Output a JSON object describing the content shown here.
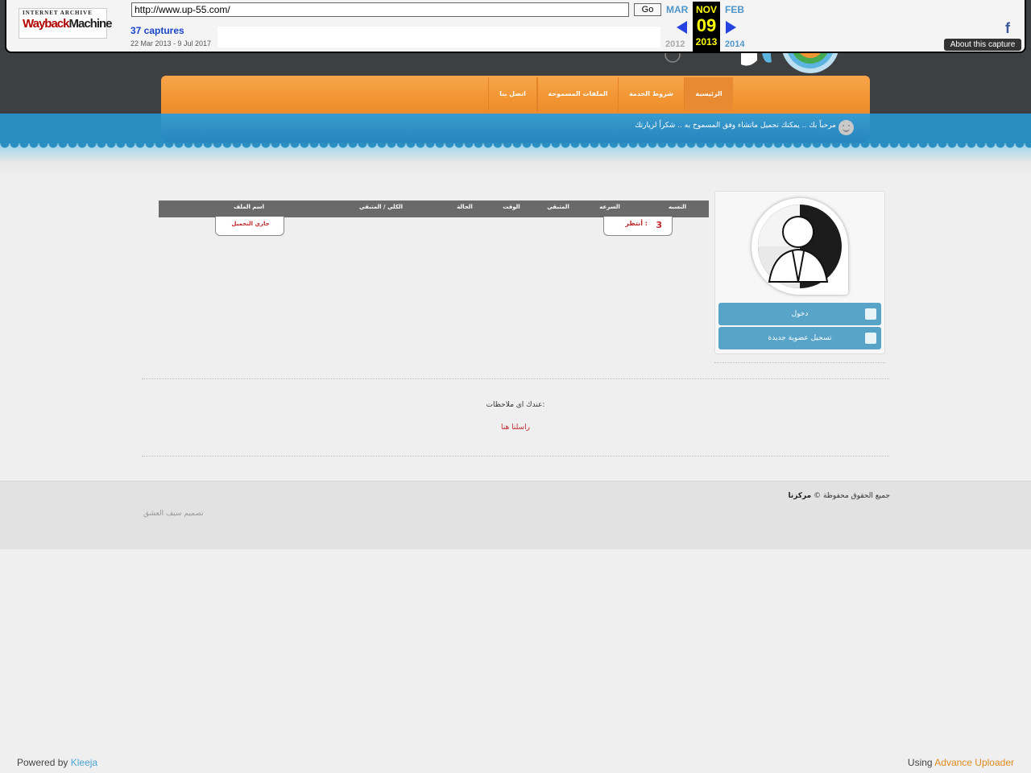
{
  "wayback": {
    "logo_top": "INTERNET ARCHIVE",
    "logo_wayback": "Wayback",
    "logo_machine": "Machine",
    "url": "http://www.up-55.com/",
    "go_label": "Go",
    "captures": "37 captures",
    "range": "22 Mar 2013 - 9 Jul 2017",
    "prev_month": "MAR",
    "cur_month": "NOV",
    "next_month": "FEB",
    "cur_day": "09",
    "prev_year": "2012",
    "cur_year": "2013",
    "next_year": "2014",
    "facebook_glyph": "f",
    "about_label": "About this capture"
  },
  "nav": {
    "home": "الرئيسية",
    "terms": "شروط الخدمة",
    "files": "الملفات المسموحة",
    "contact": "اتصل بنا"
  },
  "welcome": "مرحباً بك .. يمكنك تحميل ماتشاء وفق المسموح به .. شكراً لزيارتك",
  "sidebar": {
    "login": "دخول",
    "register": "تسجيل عضوية جديدة"
  },
  "table": {
    "headers": {
      "percent": "النسبه",
      "speed": "السرعه",
      "remaining": "المتبقي",
      "time": "الوقت",
      "status": "الحالة",
      "total": "الكلي / المتبقي",
      "filename": "اسم الملف"
    },
    "row": {
      "number": "3",
      "wait": "أنتظر :",
      "uploading": "جاري التحميل"
    }
  },
  "notes": {
    "question": "عندك اى ملاحظات:",
    "contact_link": "راسلنا هنا"
  },
  "footer": {
    "copyright_prefix": "جميع الحقوق محفوظة ©",
    "site_name": "مركزنا",
    "design": "تصميم سيف العشق",
    "powered_prefix": "Powered by",
    "powered_link": "Kleeja",
    "using_prefix": "Using",
    "using_link": "Advance Uploader"
  },
  "colors": {
    "orange": "#f29533",
    "blue": "#2a8ec3",
    "red_text": "#c0282c"
  }
}
